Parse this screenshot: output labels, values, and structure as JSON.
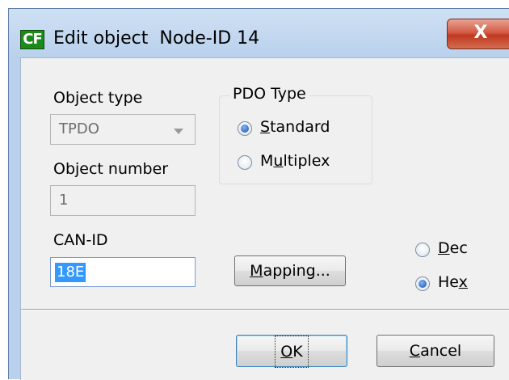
{
  "window": {
    "app_icon_text": "CF",
    "title": "Edit object  Node-ID 14",
    "close_glyph": "X"
  },
  "object_type": {
    "label": "Object type",
    "value": "TPDO"
  },
  "object_number": {
    "label": "Object number",
    "value": "1"
  },
  "pdo_type": {
    "group_label": "PDO Type",
    "options": [
      {
        "pre": "",
        "key": "S",
        "post": "tandard",
        "selected": true
      },
      {
        "pre": "M",
        "key": "u",
        "post": "ltiplex",
        "selected": false
      }
    ]
  },
  "can_id": {
    "label": "CAN-ID",
    "value": "18E"
  },
  "mapping_button": {
    "key": "M",
    "rest": "apping..."
  },
  "number_format": [
    {
      "key": "D",
      "post": "ec",
      "pre": "",
      "selected": false
    },
    {
      "key": "x",
      "post": "",
      "pre": "He",
      "selected": true
    }
  ],
  "ok_button": {
    "key": "O",
    "rest": "K"
  },
  "cancel_button": {
    "key": "C",
    "rest": "ancel"
  }
}
